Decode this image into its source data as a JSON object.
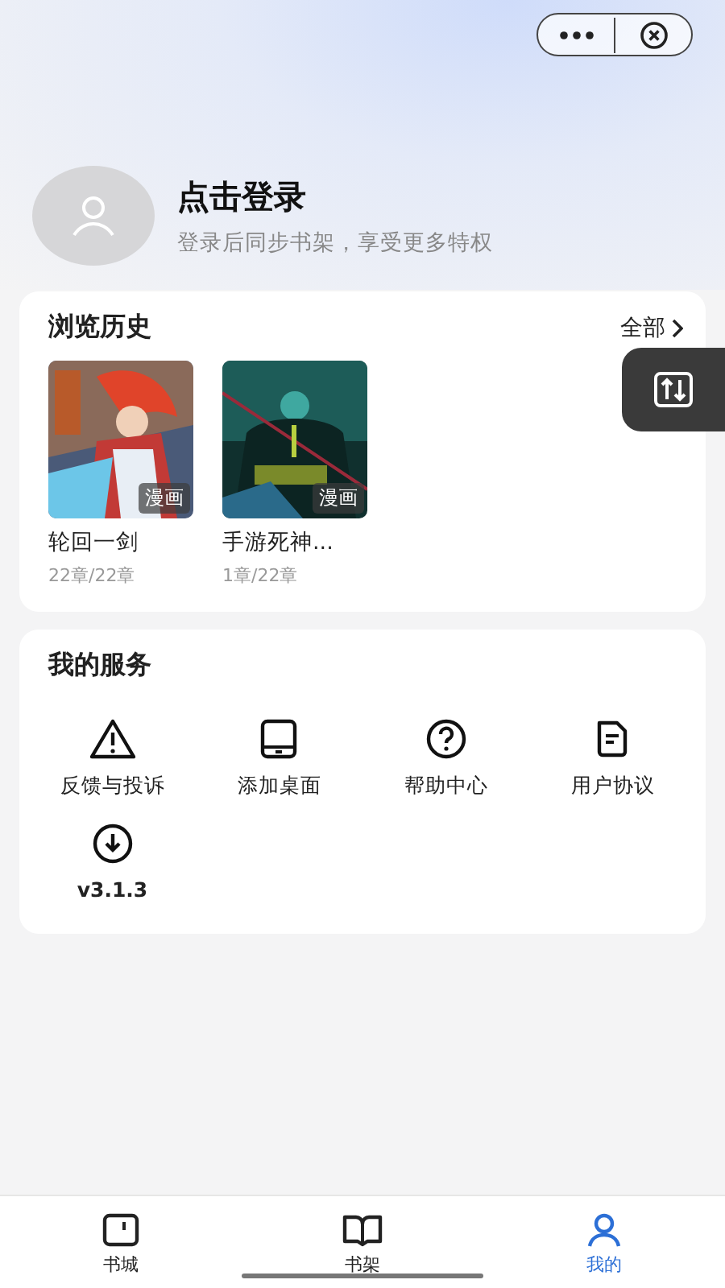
{
  "profile": {
    "title": "点击登录",
    "subtitle": "登录后同步书架，享受更多特权"
  },
  "history": {
    "title": "浏览历史",
    "more": "全部",
    "items": [
      {
        "title": "轮回一剑",
        "progress": "22章/22章",
        "badge": "漫画",
        "kind": "red"
      },
      {
        "title": "手游死神...",
        "progress": "1章/22章",
        "badge": "漫画",
        "kind": "teal"
      }
    ]
  },
  "services": {
    "title": "我的服务",
    "items": [
      {
        "label": "反馈与投诉"
      },
      {
        "label": "添加桌面"
      },
      {
        "label": "帮助中心"
      },
      {
        "label": "用户协议"
      },
      {
        "label": "v3.1.3"
      }
    ]
  },
  "tabs": [
    {
      "label": "书城",
      "selected": false
    },
    {
      "label": "书架",
      "selected": false
    },
    {
      "label": "我的",
      "selected": true
    }
  ]
}
